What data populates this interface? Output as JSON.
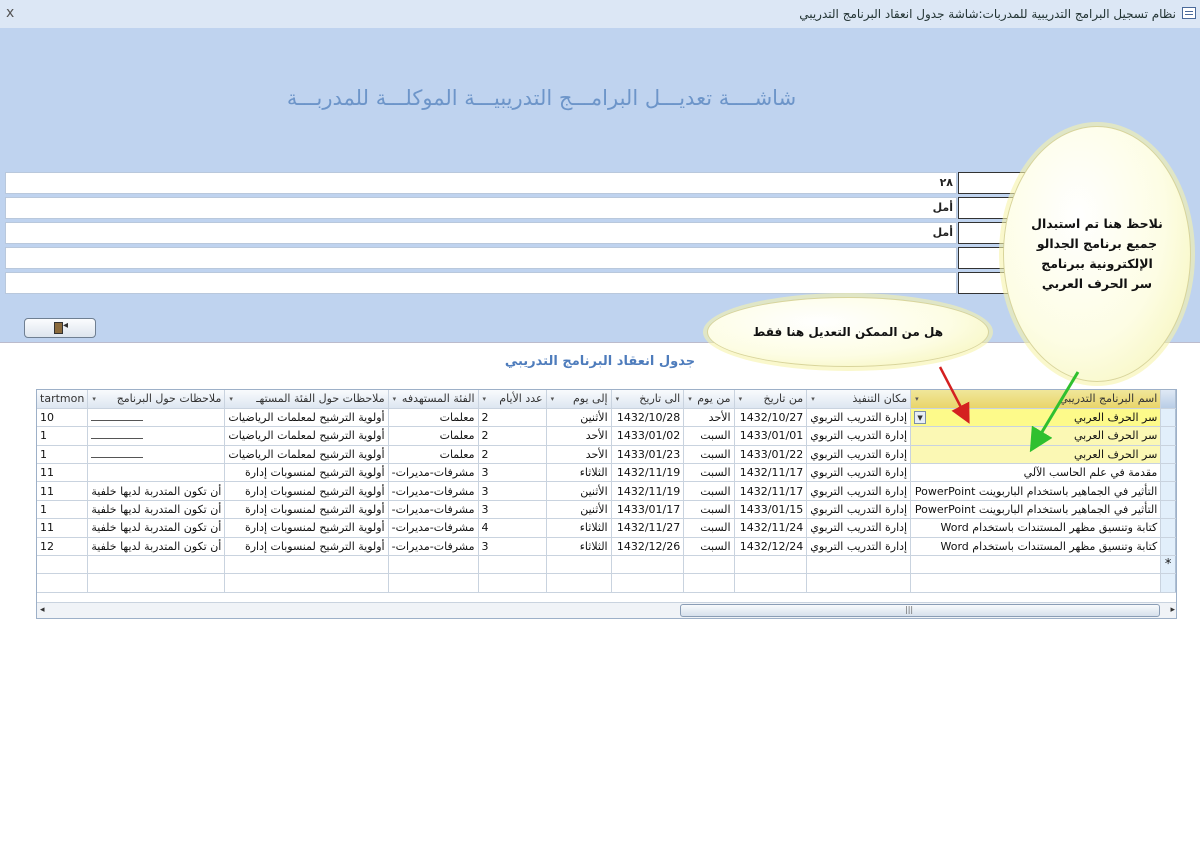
{
  "window": {
    "title": "نظام تسجيل البرامج التدريبية للمدربات:شاشة جدول انعقاد البرنامج التدريبي",
    "close_symbol": "x"
  },
  "form": {
    "heading": "شاشــــة تعديـــل البرامـــج التدريبيـــة الموكلـــة للمدربـــة",
    "fields": [
      {
        "value": "٢٨"
      },
      {
        "value": "أمل"
      },
      {
        "value": "أمل"
      },
      {
        "value": ""
      },
      {
        "value": ""
      }
    ]
  },
  "table": {
    "title": "جدول انعقاد البرنامج التدريبي",
    "columns": [
      "اسم البرنامج التدريبي",
      "مكان التنفيذ",
      "من تاريخ",
      "من يوم",
      "الى تاريخ",
      "إلى يوم",
      "عدد الأيام",
      "الفئة المستهدفه",
      "ملاحظات حول الفئة المستهـ",
      "ملاحظات حول البرنامج",
      "tartmon"
    ],
    "rows": [
      [
        "سر الحرف العربي",
        "إدارة التدريب التربوي",
        "1432/10/27",
        "الأحد",
        "1432/10/28",
        "الأثنين",
        "2",
        "معلمات",
        "أولوية الترشيح لمعلمات الرياضيات",
        "",
        "10"
      ],
      [
        "سر الحرف العربي",
        "إدارة التدريب التربوي",
        "1433/01/01",
        "السبت",
        "1433/01/02",
        "الأحد",
        "2",
        "معلمات",
        "أولوية الترشيح لمعلمات الرياضيات",
        "",
        "1"
      ],
      [
        "سر الحرف العربي",
        "إدارة التدريب التربوي",
        "1433/01/22",
        "السبت",
        "1433/01/23",
        "الأحد",
        "2",
        "معلمات",
        "أولوية الترشيح لمعلمات الرياضيات",
        "",
        "1"
      ],
      [
        "مقدمة في علم الحاسب الآلي",
        "إدارة التدريب التربوي",
        "1432/11/17",
        "السبت",
        "1432/11/19",
        "الثلاثاء",
        "3",
        "مشرفات-مديرات-",
        "أولوية الترشيح لمنسوبات إدارة",
        "",
        "11"
      ],
      [
        "التأثير في الجماهير باستخدام الباربوينت PowerPoint",
        "إدارة التدريب التربوي",
        "1432/11/17",
        "السبت",
        "1432/11/19",
        "الأثنين",
        "3",
        "مشرفات-مديرات-",
        "أولوية الترشيح لمنسوبات إدارة",
        "أن تكون المتدربة لديها خلفية",
        "11"
      ],
      [
        "التأثير في الجماهير باستخدام الباربوينت PowerPoint",
        "إدارة التدريب التربوي",
        "1433/01/15",
        "السبت",
        "1433/01/17",
        "الأثنين",
        "3",
        "مشرفات-مديرات-",
        "أولوية الترشيح لمنسوبات إدارة",
        "أن تكون المتدربة لديها خلفية",
        "1"
      ],
      [
        "كتابة وتنسيق مظهر المستندات باستخدام Word",
        "إدارة التدريب التربوي",
        "1432/11/24",
        "السبت",
        "1432/11/27",
        "الثلاثاء",
        "4",
        "مشرفات-مديرات-",
        "أولوية الترشيح لمنسوبات إدارة",
        "أن تكون المتدربة لديها خلفية",
        "11"
      ],
      [
        "كتابة وتنسيق مظهر المستندات باستخدام Word",
        "إدارة التدريب التربوي",
        "1432/12/24",
        "السبت",
        "1432/12/26",
        "الثلاثاء",
        "3",
        "مشرفات-مديرات-",
        "أولوية الترشيح لمنسوبات إدارة",
        "أن تكون المتدربة لديها خلفية",
        "12"
      ]
    ],
    "new_record_marker": "*",
    "dropdown_symbol": "▾",
    "combo_symbol": "▼"
  },
  "callouts": {
    "question": "هل من الممكن التعديل هنا فقط",
    "note": "نلاحظ هنا تم استبدال\nجميع برنامج الجدالو\nالإلكترونية ببرنامج\nسر الحرف العربي"
  },
  "colors": {
    "header_bg": "#bfd3ef",
    "heading_text": "#6d95c9",
    "table_title": "#4e7cbc",
    "highlight_yellow": "#fdfa8a",
    "arrow_red": "#d42020",
    "arrow_green": "#2fc02f"
  },
  "icons": {
    "exit_button": "exit-door-icon",
    "window": "form-window-icon",
    "record_selector": "record-selector-icon"
  }
}
